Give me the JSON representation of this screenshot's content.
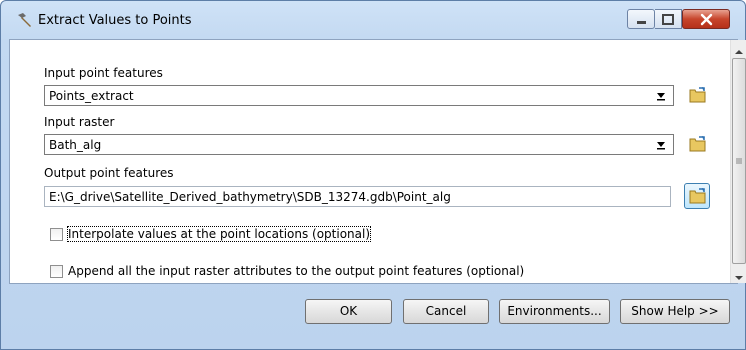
{
  "window": {
    "title": "Extract Values to Points",
    "app_icon": "hammer-icon",
    "controls": [
      "minimize-icon",
      "maximize-icon",
      "close-icon"
    ]
  },
  "form": {
    "input_point_features": {
      "label": "Input point features",
      "value": "Points_extract",
      "icon": "folder-browse-icon"
    },
    "input_raster": {
      "label": "Input raster",
      "value": "Bath_alg",
      "icon": "folder-browse-icon"
    },
    "output_point_features": {
      "label": "Output point features",
      "value": "E:\\G_drive\\Satellite_Derived_bathymetry\\SDB_13274.gdb\\Point_alg",
      "icon": "folder-browse-icon"
    },
    "interpolate": {
      "label": "Interpolate values at the point locations (optional)",
      "checked": false
    },
    "append": {
      "label": "Append all the input raster attributes to the output point features (optional)",
      "checked": false
    }
  },
  "buttons": {
    "ok": "OK",
    "cancel": "Cancel",
    "environments": "Environments...",
    "show_help": "Show Help >>"
  },
  "colors": {
    "title_bar": "#c3d9f1",
    "close_button": "#c7452c",
    "browse_active": "#bee6fd"
  }
}
